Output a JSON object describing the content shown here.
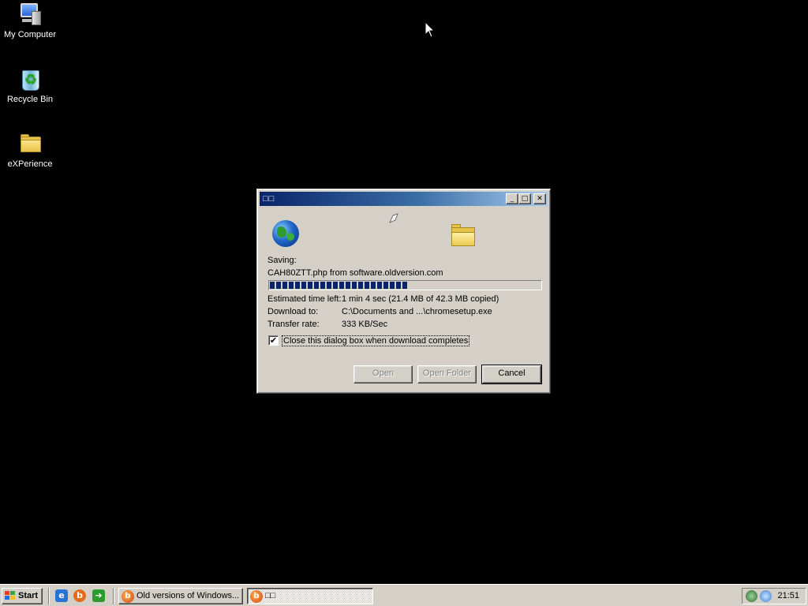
{
  "desktop": {
    "icons": [
      {
        "label": "My Computer",
        "icon": "my-computer-icon"
      },
      {
        "label": "Recycle Bin",
        "icon": "recycle-bin-icon"
      },
      {
        "label": "eXPerience",
        "icon": "folder-icon"
      }
    ]
  },
  "dialog": {
    "title": "□□",
    "saving_label": "Saving:",
    "file_source": "CAH80ZTT.php from software.oldversion.com",
    "progress": 0.51,
    "info": [
      {
        "label": "Estimated time left:",
        "value": "1 min 4 sec (21.4 MB of 42.3 MB copied)"
      },
      {
        "label": "Download to:",
        "value": "C:\\Documents and ...\\chromesetup.exe"
      },
      {
        "label": "Transfer rate:",
        "value": "333 KB/Sec"
      }
    ],
    "close_checkbox": {
      "label": "Close this dialog box when download completes",
      "checked": true,
      "mark": "✔"
    },
    "buttons": {
      "open": "Open",
      "open_folder": "Open Folder",
      "cancel": "Cancel"
    },
    "title_buttons": {
      "minimize": "_",
      "maximize": "□",
      "close": "✕"
    }
  },
  "taskbar": {
    "start_label": "Start",
    "quick_launch": [
      {
        "icon": "ie-icon",
        "glyph": "e",
        "color": "#2a73d6"
      },
      {
        "icon": "firefox-icon",
        "glyph": "b",
        "color": "#e36a1b"
      },
      {
        "icon": "show-desktop-icon",
        "glyph": "➔",
        "color": "#2e9b2e"
      }
    ],
    "tasks": [
      {
        "label": "Old versions of Windows...",
        "active": false
      },
      {
        "label": "□□",
        "active": true
      }
    ],
    "clock": "21:51"
  }
}
